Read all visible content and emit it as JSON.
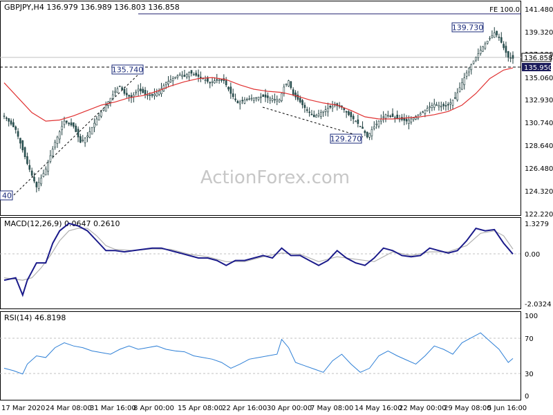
{
  "chart_data": [
    {
      "type": "candlestick",
      "title": "GBPJPY,H4  136.979 136.989 136.803 136.858",
      "annotation_top": "FE 100.0",
      "watermark": "ActionForex.com",
      "ylim": [
        122.22,
        141.48
      ],
      "yticks": [
        "141.480",
        "139.320",
        "137.180",
        "135.060",
        "132.930",
        "130.740",
        "128.640",
        "126.480",
        "124.320",
        "122.220"
      ],
      "xticks": [
        "17 Mar 2020",
        "24 Mar 08:00",
        "31 Mar 16:00",
        "8 Apr 00:00",
        "15 Apr 08:00",
        "22 Apr 16:00",
        "30 Apr 00:00",
        "7 May 08:00",
        "14 May 16:00",
        "22 May 00:00",
        "29 May 08:00",
        "5 Jun 16:00"
      ],
      "current_price": "136.858",
      "level_line": "135.950",
      "labels": [
        "139.730",
        "135.740",
        "129.270",
        "40"
      ],
      "close_path": [
        [
          0,
          131.5
        ],
        [
          5,
          130.2
        ],
        [
          10,
          127.0
        ],
        [
          14,
          124.8
        ],
        [
          18,
          126.5
        ],
        [
          22,
          129.0
        ],
        [
          26,
          131.0
        ],
        [
          30,
          130.5
        ],
        [
          33,
          129.0
        ],
        [
          36,
          129.6
        ],
        [
          40,
          131.2
        ],
        [
          44,
          132.5
        ],
        [
          48,
          133.8
        ],
        [
          50,
          134.3
        ],
        [
          52,
          133.6
        ],
        [
          55,
          133.2
        ],
        [
          58,
          134.0
        ],
        [
          61,
          133.5
        ],
        [
          64,
          133.4
        ],
        [
          67,
          133.8
        ],
        [
          70,
          134.6
        ],
        [
          73,
          135.0
        ],
        [
          76,
          135.4
        ],
        [
          78,
          135.2
        ],
        [
          80,
          135.6
        ],
        [
          83,
          135.3
        ],
        [
          86,
          135.0
        ],
        [
          89,
          134.6
        ],
        [
          92,
          134.9
        ],
        [
          95,
          134.8
        ],
        [
          98,
          133.6
        ],
        [
          101,
          132.7
        ],
        [
          104,
          133.0
        ],
        [
          108,
          133.2
        ],
        [
          112,
          133.3
        ],
        [
          116,
          133.1
        ],
        [
          119,
          133.0
        ],
        [
          121,
          134.2
        ],
        [
          123,
          134.8
        ],
        [
          125,
          133.5
        ],
        [
          128,
          132.8
        ],
        [
          131,
          132.0
        ],
        [
          134,
          131.4
        ],
        [
          137,
          131.8
        ],
        [
          140,
          132.2
        ],
        [
          143,
          132.5
        ],
        [
          146,
          132.3
        ],
        [
          149,
          131.6
        ],
        [
          152,
          131.0
        ],
        [
          155,
          130.3
        ],
        [
          157,
          129.5
        ],
        [
          159,
          130.2
        ],
        [
          162,
          131.0
        ],
        [
          165,
          131.6
        ],
        [
          168,
          131.4
        ],
        [
          171,
          131.2
        ],
        [
          174,
          131.0
        ],
        [
          177,
          131.3
        ],
        [
          180,
          131.7
        ],
        [
          183,
          132.2
        ],
        [
          186,
          132.6
        ],
        [
          189,
          132.4
        ],
        [
          192,
          132.5
        ],
        [
          195,
          133.2
        ],
        [
          198,
          134.6
        ],
        [
          201,
          136.0
        ],
        [
          204,
          137.0
        ],
        [
          207,
          138.0
        ],
        [
          210,
          138.8
        ],
        [
          212,
          139.3
        ],
        [
          214,
          138.9
        ],
        [
          216,
          137.9
        ],
        [
          218,
          137.0
        ],
        [
          220,
          136.9
        ]
      ],
      "ma_path": [
        [
          0,
          134.6
        ],
        [
          6,
          133.2
        ],
        [
          12,
          131.8
        ],
        [
          18,
          131.0
        ],
        [
          24,
          131.1
        ],
        [
          30,
          131.5
        ],
        [
          36,
          132.0
        ],
        [
          42,
          132.5
        ],
        [
          48,
          132.8
        ],
        [
          54,
          133.2
        ],
        [
          60,
          133.4
        ],
        [
          66,
          133.8
        ],
        [
          72,
          134.3
        ],
        [
          78,
          134.7
        ],
        [
          84,
          135.0
        ],
        [
          90,
          135.1
        ],
        [
          96,
          134.9
        ],
        [
          102,
          134.4
        ],
        [
          108,
          134.0
        ],
        [
          114,
          133.8
        ],
        [
          120,
          133.7
        ],
        [
          126,
          133.4
        ],
        [
          132,
          133.0
        ],
        [
          138,
          132.7
        ],
        [
          144,
          132.5
        ],
        [
          150,
          132.0
        ],
        [
          156,
          131.4
        ],
        [
          162,
          131.2
        ],
        [
          168,
          131.2
        ],
        [
          174,
          131.3
        ],
        [
          180,
          131.4
        ],
        [
          186,
          131.6
        ],
        [
          192,
          131.9
        ],
        [
          198,
          132.5
        ],
        [
          204,
          133.6
        ],
        [
          210,
          135.0
        ],
        [
          216,
          135.8
        ],
        [
          220,
          136.0
        ]
      ]
    },
    {
      "type": "line",
      "title": "MACD(12,26,9) 0.0647 0.2610",
      "ylim": [
        -2.0324,
        1.3279
      ],
      "yticks": [
        "1.3279",
        "0.00",
        "-2.0324"
      ],
      "macd": [
        [
          0,
          -1.0
        ],
        [
          5,
          -0.9
        ],
        [
          8,
          -1.6
        ],
        [
          10,
          -1.0
        ],
        [
          14,
          -0.3
        ],
        [
          18,
          -0.3
        ],
        [
          21,
          0.5
        ],
        [
          24,
          1.0
        ],
        [
          28,
          1.3
        ],
        [
          32,
          1.2
        ],
        [
          36,
          1.0
        ],
        [
          40,
          0.6
        ],
        [
          44,
          0.2
        ],
        [
          48,
          0.2
        ],
        [
          52,
          0.15
        ],
        [
          56,
          0.2
        ],
        [
          60,
          0.25
        ],
        [
          64,
          0.3
        ],
        [
          68,
          0.3
        ],
        [
          72,
          0.2
        ],
        [
          76,
          0.1
        ],
        [
          80,
          0.0
        ],
        [
          84,
          -0.1
        ],
        [
          88,
          -0.1
        ],
        [
          92,
          -0.2
        ],
        [
          96,
          -0.4
        ],
        [
          100,
          -0.2
        ],
        [
          104,
          -0.2
        ],
        [
          108,
          -0.1
        ],
        [
          112,
          0.0
        ],
        [
          116,
          -0.1
        ],
        [
          120,
          0.3
        ],
        [
          124,
          0.0
        ],
        [
          128,
          0.0
        ],
        [
          132,
          -0.2
        ],
        [
          136,
          -0.4
        ],
        [
          140,
          -0.2
        ],
        [
          144,
          0.2
        ],
        [
          148,
          -0.1
        ],
        [
          152,
          -0.3
        ],
        [
          156,
          -0.4
        ],
        [
          160,
          -0.1
        ],
        [
          164,
          0.3
        ],
        [
          168,
          0.2
        ],
        [
          172,
          0.0
        ],
        [
          176,
          -0.05
        ],
        [
          180,
          0.0
        ],
        [
          184,
          0.3
        ],
        [
          188,
          0.2
        ],
        [
          192,
          0.1
        ],
        [
          196,
          0.2
        ],
        [
          200,
          0.6
        ],
        [
          204,
          1.1
        ],
        [
          208,
          1.0
        ],
        [
          212,
          1.05
        ],
        [
          216,
          0.5
        ],
        [
          220,
          0.06
        ]
      ],
      "signal": [
        [
          0,
          -0.9
        ],
        [
          8,
          -1.0
        ],
        [
          12,
          -0.9
        ],
        [
          16,
          -0.5
        ],
        [
          20,
          0.0
        ],
        [
          24,
          0.6
        ],
        [
          28,
          1.0
        ],
        [
          32,
          1.1
        ],
        [
          36,
          1.1
        ],
        [
          40,
          0.8
        ],
        [
          44,
          0.4
        ],
        [
          48,
          0.25
        ],
        [
          56,
          0.2
        ],
        [
          64,
          0.27
        ],
        [
          72,
          0.25
        ],
        [
          80,
          0.05
        ],
        [
          88,
          -0.05
        ],
        [
          96,
          -0.25
        ],
        [
          104,
          -0.25
        ],
        [
          112,
          -0.05
        ],
        [
          120,
          0.1
        ],
        [
          128,
          0.05
        ],
        [
          136,
          -0.25
        ],
        [
          144,
          -0.05
        ],
        [
          152,
          -0.15
        ],
        [
          160,
          -0.25
        ],
        [
          168,
          0.15
        ],
        [
          176,
          0.0
        ],
        [
          184,
          0.15
        ],
        [
          192,
          0.15
        ],
        [
          200,
          0.4
        ],
        [
          206,
          0.9
        ],
        [
          212,
          1.0
        ],
        [
          216,
          0.8
        ],
        [
          220,
          0.26
        ]
      ]
    },
    {
      "type": "line",
      "title": "RSI(14) 46.8198",
      "ylim": [
        0,
        100
      ],
      "yticks": [
        "100",
        "70",
        "30",
        "0"
      ],
      "levels": [
        70,
        30
      ],
      "rsi": [
        [
          0,
          35
        ],
        [
          4,
          32
        ],
        [
          8,
          28
        ],
        [
          10,
          40
        ],
        [
          14,
          50
        ],
        [
          18,
          48
        ],
        [
          22,
          60
        ],
        [
          26,
          66
        ],
        [
          30,
          62
        ],
        [
          34,
          60
        ],
        [
          38,
          56
        ],
        [
          42,
          54
        ],
        [
          46,
          52
        ],
        [
          50,
          58
        ],
        [
          54,
          62
        ],
        [
          58,
          58
        ],
        [
          62,
          60
        ],
        [
          66,
          62
        ],
        [
          70,
          58
        ],
        [
          74,
          56
        ],
        [
          78,
          55
        ],
        [
          82,
          50
        ],
        [
          86,
          48
        ],
        [
          90,
          46
        ],
        [
          94,
          42
        ],
        [
          98,
          35
        ],
        [
          102,
          40
        ],
        [
          106,
          46
        ],
        [
          110,
          48
        ],
        [
          114,
          50
        ],
        [
          118,
          52
        ],
        [
          120,
          70
        ],
        [
          123,
          60
        ],
        [
          126,
          42
        ],
        [
          130,
          38
        ],
        [
          134,
          34
        ],
        [
          138,
          30
        ],
        [
          142,
          44
        ],
        [
          146,
          52
        ],
        [
          150,
          40
        ],
        [
          154,
          30
        ],
        [
          158,
          35
        ],
        [
          162,
          50
        ],
        [
          166,
          56
        ],
        [
          170,
          50
        ],
        [
          174,
          45
        ],
        [
          178,
          40
        ],
        [
          182,
          50
        ],
        [
          186,
          62
        ],
        [
          190,
          58
        ],
        [
          194,
          52
        ],
        [
          198,
          66
        ],
        [
          202,
          72
        ],
        [
          206,
          78
        ],
        [
          210,
          68
        ],
        [
          214,
          58
        ],
        [
          218,
          42
        ],
        [
          220,
          46.8
        ]
      ]
    }
  ]
}
